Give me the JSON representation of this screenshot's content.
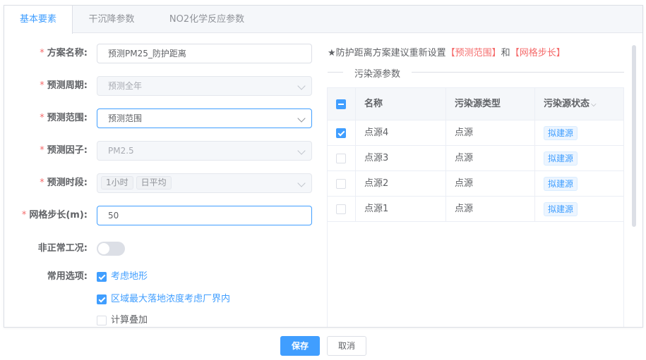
{
  "tabs": [
    {
      "label": "基本要素"
    },
    {
      "label": "干沉降参数"
    },
    {
      "label": "NO2化学反应参数"
    }
  ],
  "form": {
    "scheme_name": {
      "label": "方案名称:",
      "value": "预测PM25_防护距离"
    },
    "period": {
      "label": "预测周期:",
      "value": "预测全年"
    },
    "range": {
      "label": "预测范围:",
      "value": "预测范围"
    },
    "factor": {
      "label": "预测因子:",
      "value": "PM2.5"
    },
    "time_slot": {
      "label": "预测时段:",
      "tags": [
        "1小时",
        "日平均"
      ]
    },
    "grid_step": {
      "label": "网格步长(m):",
      "value": "50"
    },
    "abnormal": {
      "label": "非正常工况:",
      "on": false
    },
    "options": {
      "label": "常用选项:",
      "items": [
        {
          "label": "考虑地形",
          "checked": true
        },
        {
          "label": "区域最大落地浓度考虑厂界内",
          "checked": true
        },
        {
          "label": "计算叠加",
          "checked": false
        }
      ]
    }
  },
  "notice": {
    "prefix": "★防护距离方案建议重新设置",
    "hl1": "【预测范围】",
    "mid": "和",
    "hl2": "【网格步长】"
  },
  "pollution_section": {
    "title": "污染源参数"
  },
  "table": {
    "headers": [
      "名称",
      "污染源类型",
      "污染源状态"
    ],
    "sort_icon": "⌵",
    "rows": [
      {
        "name": "点源4",
        "type": "点源",
        "status": "拟建源",
        "checked": true
      },
      {
        "name": "点源3",
        "type": "点源",
        "status": "拟建源",
        "checked": false
      },
      {
        "name": "点源2",
        "type": "点源",
        "status": "拟建源",
        "checked": false
      },
      {
        "name": "点源1",
        "type": "点源",
        "status": "拟建源",
        "checked": false
      }
    ]
  },
  "buttons": {
    "save": "保存",
    "cancel": "取消"
  },
  "colors": {
    "primary": "#409eff",
    "required": "#f56c6c"
  }
}
